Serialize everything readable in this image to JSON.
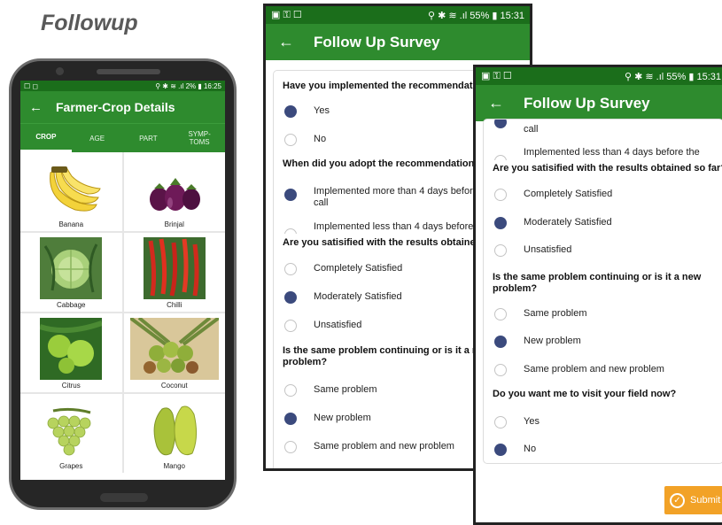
{
  "heading": "Followup",
  "phone": {
    "status_left": "☐ ◻",
    "status_right": "⚲ ✱ ≋ .ıl 2% ▮ 16:25",
    "app_title": "Farmer-Crop Details",
    "tabs": [
      "CROP",
      "AGE",
      "PART",
      "SYMP-\nTOMS"
    ],
    "active_tab": "CROP",
    "crops": [
      {
        "name": "Banana",
        "icon": "banana-icon"
      },
      {
        "name": "Brinjal",
        "icon": "brinjal-icon"
      },
      {
        "name": "Cabbage",
        "icon": "cabbage-icon"
      },
      {
        "name": "Chilli",
        "icon": "chilli-icon"
      },
      {
        "name": "Citrus",
        "icon": "citrus-icon"
      },
      {
        "name": "Coconut",
        "icon": "coconut-icon"
      },
      {
        "name": "Grapes",
        "icon": "grapes-icon"
      },
      {
        "name": "Mango",
        "icon": "mango-icon"
      }
    ]
  },
  "survey1": {
    "status_left": "▣ ⚿ ☐",
    "status_right": "⚲ ✱ ≋ .ıl 55% ▮ 15:31",
    "title": "Follow Up Survey",
    "q1": "Have you implemented the recommendation?",
    "q1_opts": [
      "Yes",
      "No"
    ],
    "q2": "When did you adopt the recommendation?",
    "q2_opt1_line1": "Implemented more than 4 days before the",
    "q2_opt1_line2": "call",
    "q2_opt2": "Implemented less than 4 days before the",
    "q3": "Are you satisified with the results obtained so far?",
    "q3_opts": [
      "Completely Satisfied",
      "Moderately Satisfied",
      "Unsatisfied"
    ],
    "q4_line1": "Is the same problem continuing or is it a new",
    "q4_line2": "problem?",
    "q4_opts": [
      "Same problem",
      "New problem",
      "Same problem and new problem"
    ]
  },
  "survey2": {
    "status_left": "▣ ⚿ ☐",
    "status_right": "⚲ ✱ ≋ .ıl 55% ▮ 15:31",
    "title": "Follow Up Survey",
    "call_text": "call",
    "partial_opt": "Implemented less than 4 days before the",
    "q3": "Are you satisified with the results obtained so far?",
    "q3_opts": [
      "Completely Satisfied",
      "Moderately Satisfied",
      "Unsatisfied"
    ],
    "q4_line1": "Is the same problem continuing or is it a new",
    "q4_line2": "problem?",
    "q4_opts": [
      "Same problem",
      "New problem",
      "Same problem and new problem"
    ],
    "q5": "Do you want me to visit your field now?",
    "q5_opts": [
      "Yes",
      "No"
    ],
    "submit_label": "Submit"
  },
  "colors": {
    "green": "#2e8b2e",
    "dark_green": "#1b6e1b",
    "radio_selected": "#3b4a7d",
    "submit": "#f2a227"
  }
}
